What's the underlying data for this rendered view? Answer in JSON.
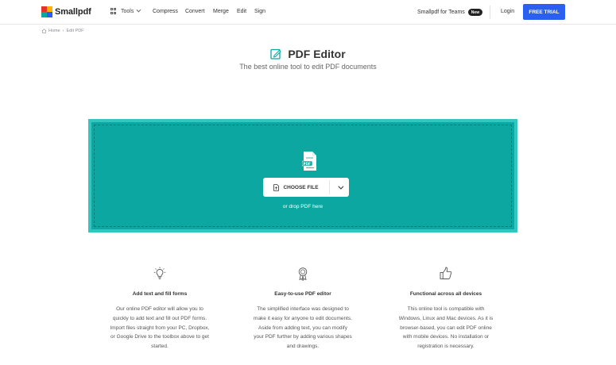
{
  "header": {
    "logo_text": "Smallpdf",
    "tools_label": "Tools",
    "nav": [
      "Compress",
      "Convert",
      "Merge",
      "Edit",
      "Sign"
    ],
    "teams_label": "Smallpdf for Teams",
    "new_badge": "New",
    "login_label": "Login",
    "trial_label": "FREE TRIAL"
  },
  "breadcrumb": {
    "home": "Home",
    "separator": "›",
    "current": "Edit PDF"
  },
  "hero": {
    "title": "PDF Editor",
    "subtitle": "The best online tool to edit PDF documents"
  },
  "upload": {
    "choose_label": "CHOOSE FILE",
    "drop_hint": "or drop PDF here"
  },
  "features": [
    {
      "icon": "lightbulb-icon",
      "title": "Add text and fill forms",
      "description": "Our online PDF editor will allow you to quickly to add text and fill out PDF forms. Import files straight from your PC, Dropbox, or Google Drive to the toolbox above to get started."
    },
    {
      "icon": "award-ribbon-icon",
      "title": "Easy-to-use PDF editor",
      "description": "The simplified interface was designed to make it easy for anyone to edit documents. Aside from adding text, you can modify your PDF further by adding various shapes and drawings."
    },
    {
      "icon": "thumbs-up-icon",
      "title": "Functional across all devices",
      "description": "This online tool is compatible with Windows, Linux and Mac devices. As it is browser-based, you can edit PDF online with mobile devices. No installation or registration is necessary."
    }
  ],
  "colors": {
    "brand_blue": "#2b5fef",
    "drop_teal": "#0ba7a0",
    "drop_border": "#33c6c0"
  }
}
